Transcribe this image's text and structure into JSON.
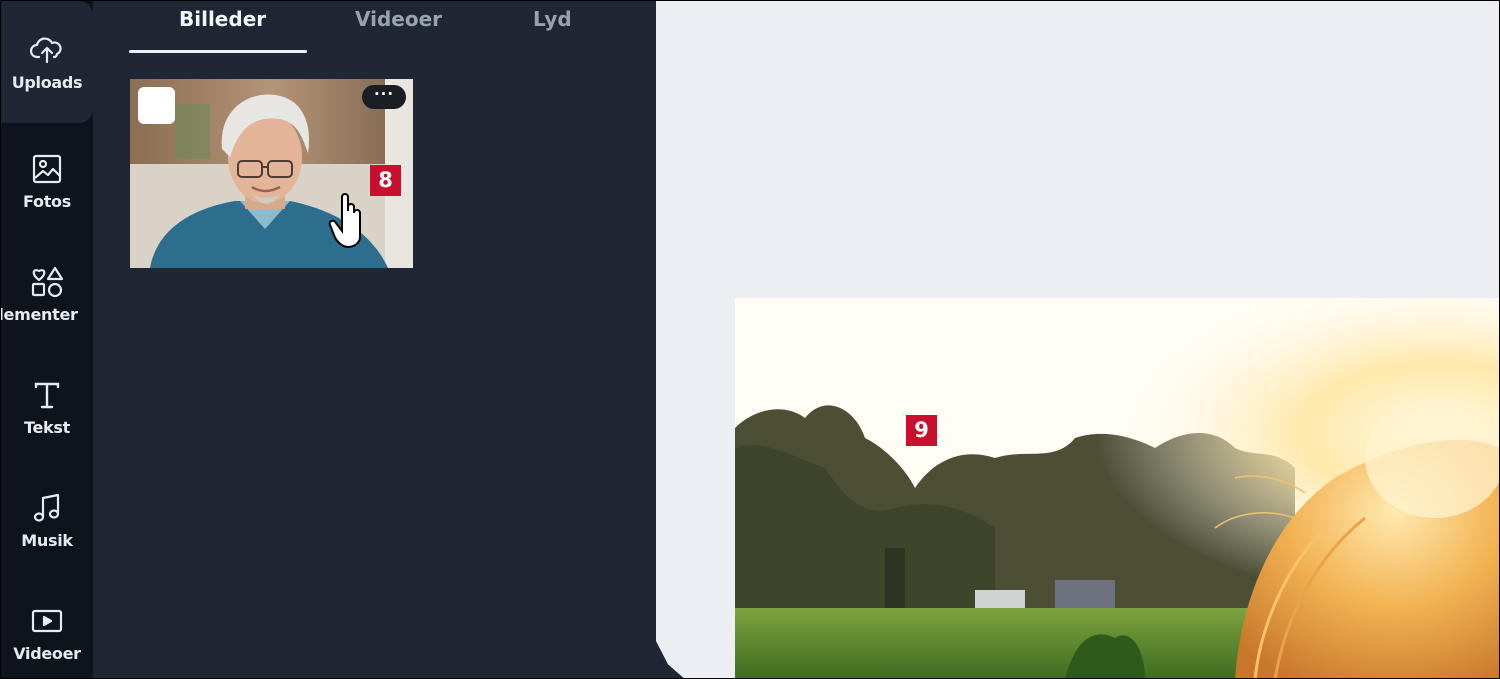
{
  "rail": {
    "items": [
      {
        "label": "Uploads",
        "icon": "cloud-upload-icon"
      },
      {
        "label": "Fotos",
        "icon": "image-icon"
      },
      {
        "label": "lementer",
        "icon": "shapes-icon"
      },
      {
        "label": "Tekst",
        "icon": "text-icon"
      },
      {
        "label": "Musik",
        "icon": "music-note-icon"
      },
      {
        "label": "Videoer",
        "icon": "video-icon"
      }
    ]
  },
  "tabs": [
    {
      "label": "Billeder",
      "active": true
    },
    {
      "label": "Videoer",
      "active": false
    },
    {
      "label": "Lyd",
      "active": false
    }
  ],
  "thumbnail": {
    "more_label": "···",
    "badge": "8"
  },
  "canvas": {
    "badge": "9"
  },
  "colors": {
    "rail_bg": "#0e141b",
    "panel_bg": "#1e2733",
    "canvas_bg": "#ebeef2",
    "badge_red": "#c8102e"
  }
}
